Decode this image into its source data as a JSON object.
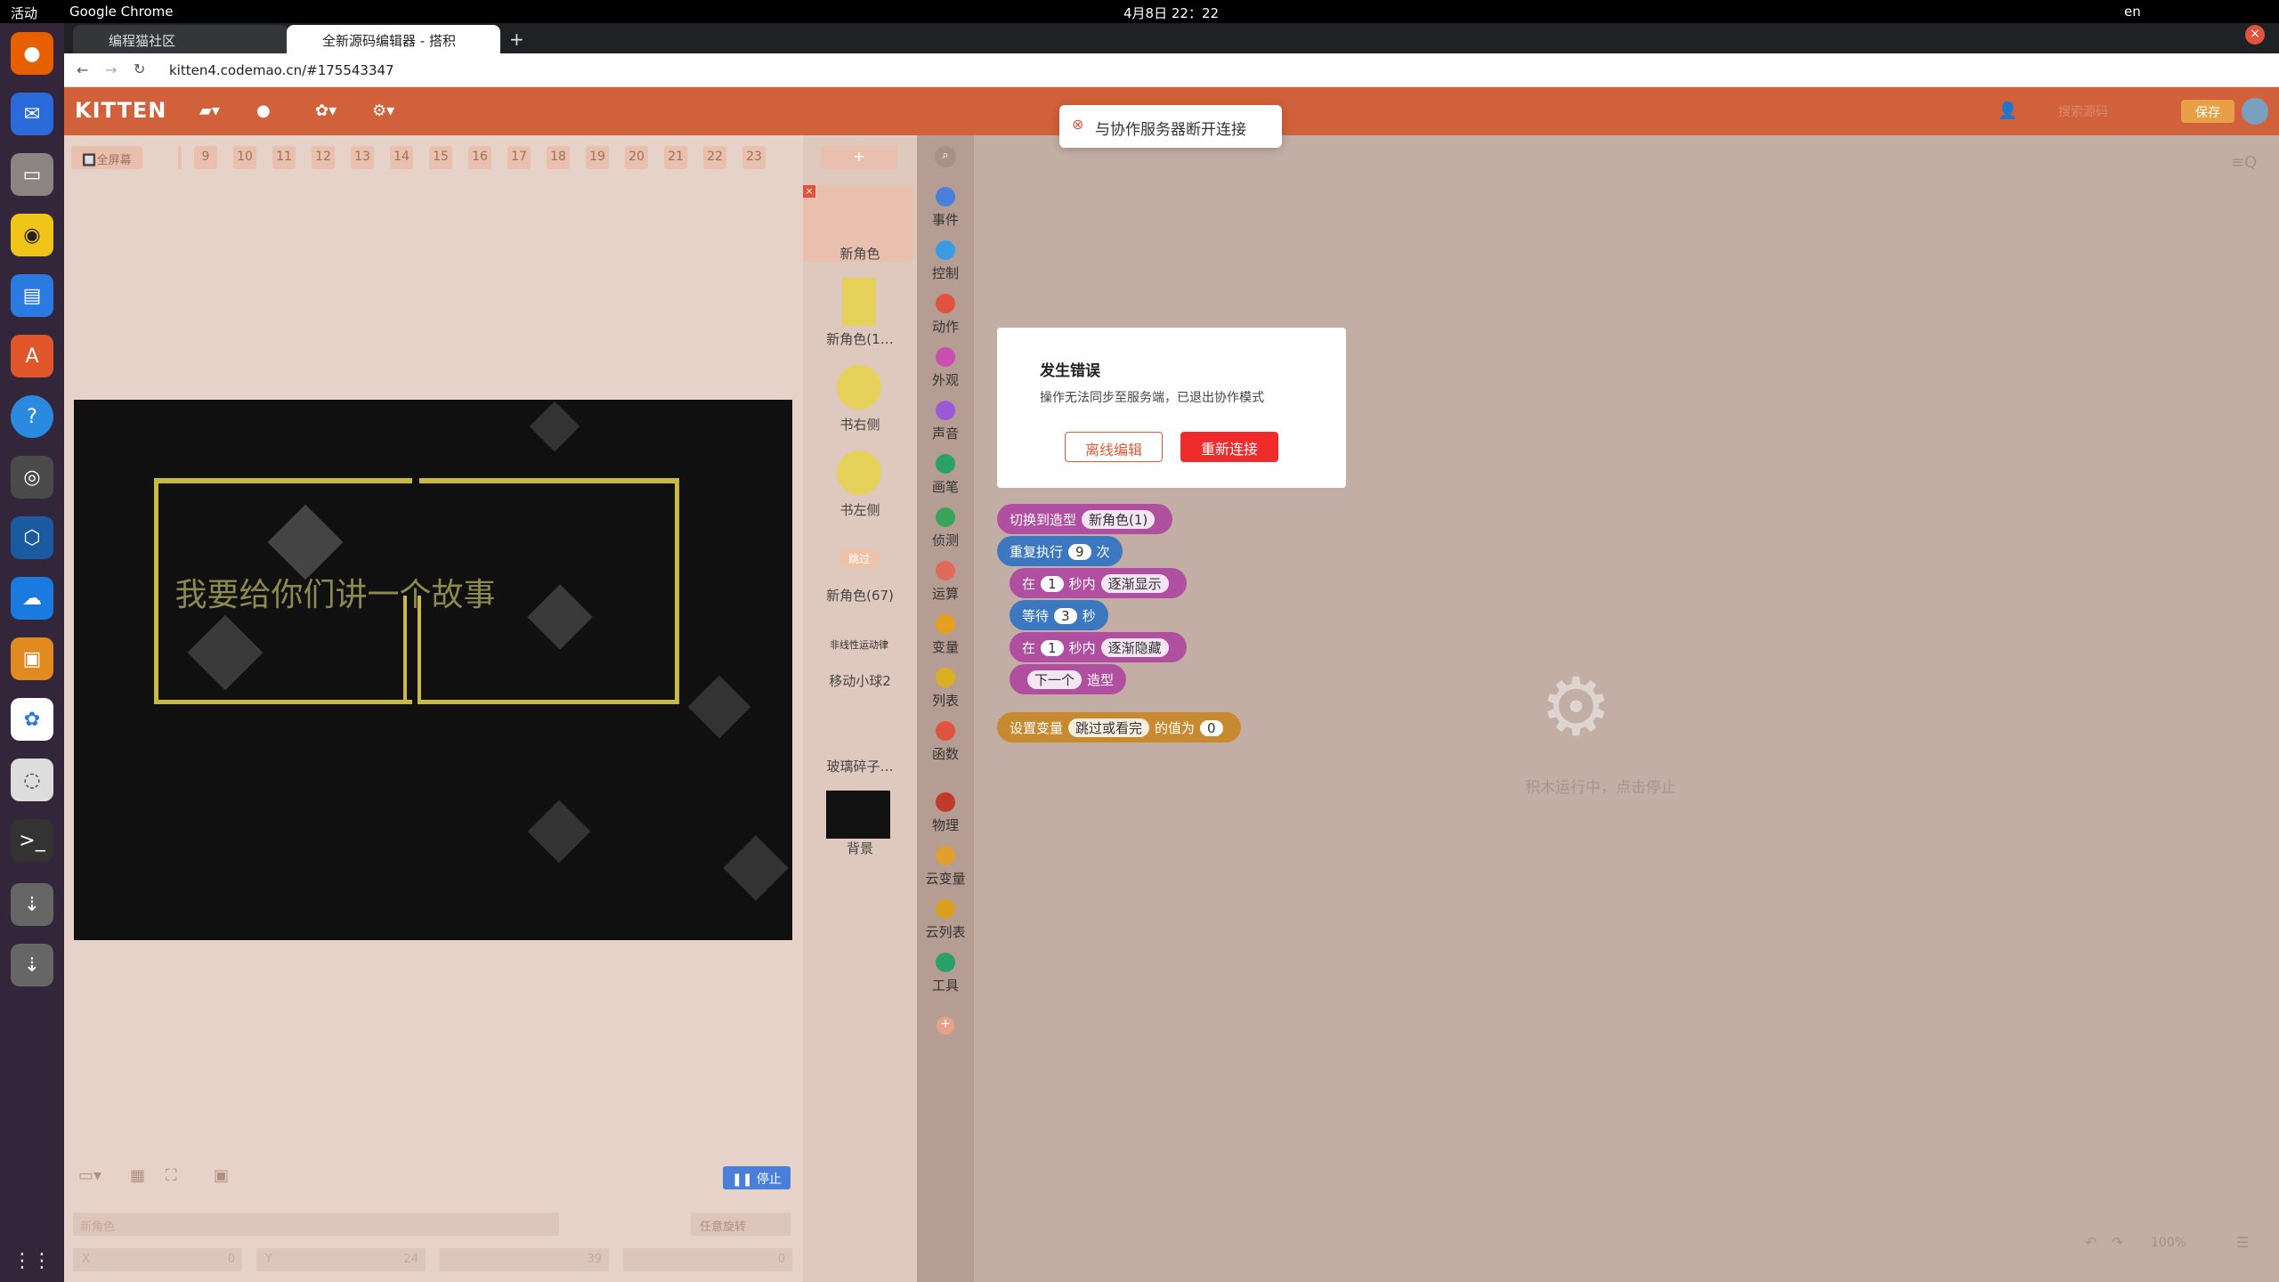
{
  "system": {
    "activities": "活动",
    "app": "Google Chrome",
    "clock": "4月8日 22：22",
    "lang": "en"
  },
  "browser": {
    "tabs": [
      {
        "title": "编程猫社区"
      },
      {
        "title": "全新源码编辑器 - 搭积"
      }
    ],
    "url": "kitten4.codemao.cn/#175543347"
  },
  "app": {
    "logo": "KITTEN",
    "save": "保存",
    "search_placeholder": "搜索源码",
    "fullscreen": "🔲全屏幕",
    "tab_numbers": [
      "9",
      "10",
      "11",
      "12",
      "13",
      "14",
      "15",
      "16",
      "17",
      "18",
      "19",
      "20",
      "21",
      "22",
      "23"
    ],
    "add_btn": "+",
    "stage_text": "我要给你们讲一个故事",
    "stop": "停止",
    "sprites": [
      {
        "name": "新角色"
      },
      {
        "name": "新角色(1…"
      },
      {
        "name": "书右侧"
      },
      {
        "name": "书左侧"
      },
      {
        "name": "新角色(67)",
        "chip": "跳过"
      },
      {
        "name": "移动小球2",
        "chip": "非线性运动律"
      },
      {
        "name": "玻璃碎子…"
      },
      {
        "name": "背景"
      }
    ],
    "categories": [
      {
        "label": "事件",
        "color": "#4a7fd9"
      },
      {
        "label": "控制",
        "color": "#3b9be0"
      },
      {
        "label": "动作",
        "color": "#e0533e"
      },
      {
        "label": "外观",
        "color": "#c94fb0"
      },
      {
        "label": "声音",
        "color": "#9a5ad6"
      },
      {
        "label": "画笔",
        "color": "#2aa06a"
      },
      {
        "label": "侦测",
        "color": "#3aa35a"
      },
      {
        "label": "运算",
        "color": "#e06a5a"
      },
      {
        "label": "变量",
        "color": "#e5a020"
      },
      {
        "label": "列表",
        "color": "#d9b020"
      },
      {
        "label": "函数",
        "color": "#e0533e"
      },
      {
        "label": "物理",
        "color": "#c0392b"
      },
      {
        "label": "云变量",
        "color": "#e0a030"
      },
      {
        "label": "云列表",
        "color": "#d9a020"
      },
      {
        "label": "工具",
        "color": "#2aa06a"
      }
    ],
    "blocks": {
      "switch": "切换到造型",
      "switch_val": "新角色(1)",
      "repeat": "重复执行",
      "repeat_n": "9",
      "times": "次",
      "in1": "在",
      "in1_n": "1",
      "in1_sec": "秒内",
      "in1_dd": "逐渐显示",
      "wait": "等待",
      "wait_n": "3",
      "wait_sec": "秒",
      "in2": "在",
      "in2_n": "1",
      "in2_sec": "秒内",
      "in2_dd": "逐渐隐藏",
      "next": "下一个",
      "costume": "造型",
      "setvar": "设置变量",
      "setvar_dd": "跳过或看完",
      "setvar_to": "的值为",
      "setvar_n": "0"
    },
    "running": "积木运行中，点击停止",
    "zoom": "100%",
    "props": {
      "name_placeholder": "新角色",
      "x_label": "X",
      "x_val": "0",
      "y_label": "Y",
      "y_val": "24",
      "size_val": "39",
      "rot_val": "0",
      "rotate_mode": "任意旋转"
    }
  },
  "toast": {
    "text": "与协作服务器断开连接"
  },
  "dialog": {
    "title": "发生错误",
    "message": "操作无法同步至服务端，已退出协作模式",
    "offline": "离线编辑",
    "reconnect": "重新连接"
  }
}
